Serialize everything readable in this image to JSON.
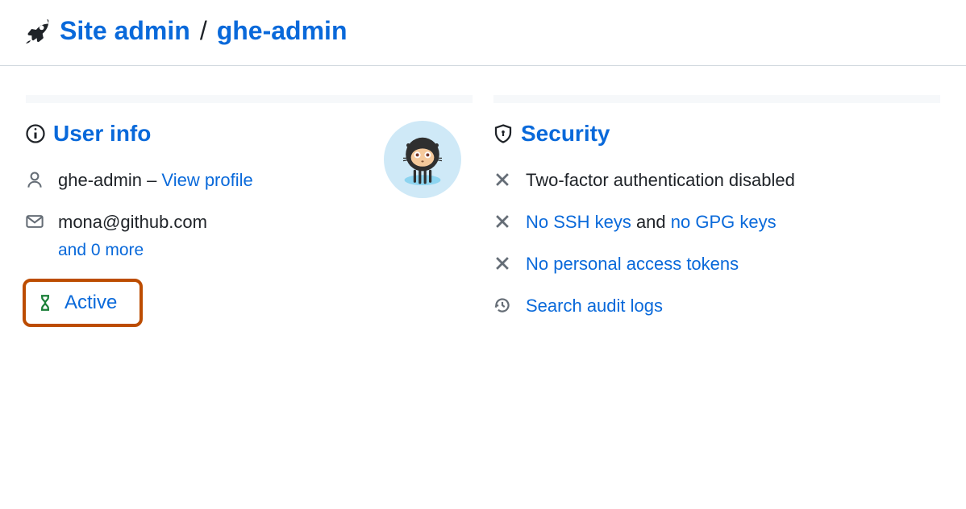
{
  "breadcrumb": {
    "site_admin": "Site admin",
    "separator": "/",
    "user": "ghe-admin"
  },
  "user_info": {
    "heading": "User info",
    "username": "ghe-admin",
    "dash": " – ",
    "view_profile": "View profile",
    "email": "mona@github.com",
    "more_emails": "and 0 more",
    "active": "Active"
  },
  "security": {
    "heading": "Security",
    "twofa": "Two-factor authentication disabled",
    "no_ssh": "No SSH keys",
    "and": " and ",
    "no_gpg": "no GPG keys",
    "no_tokens": "No personal access tokens",
    "search_logs": "Search audit logs"
  }
}
